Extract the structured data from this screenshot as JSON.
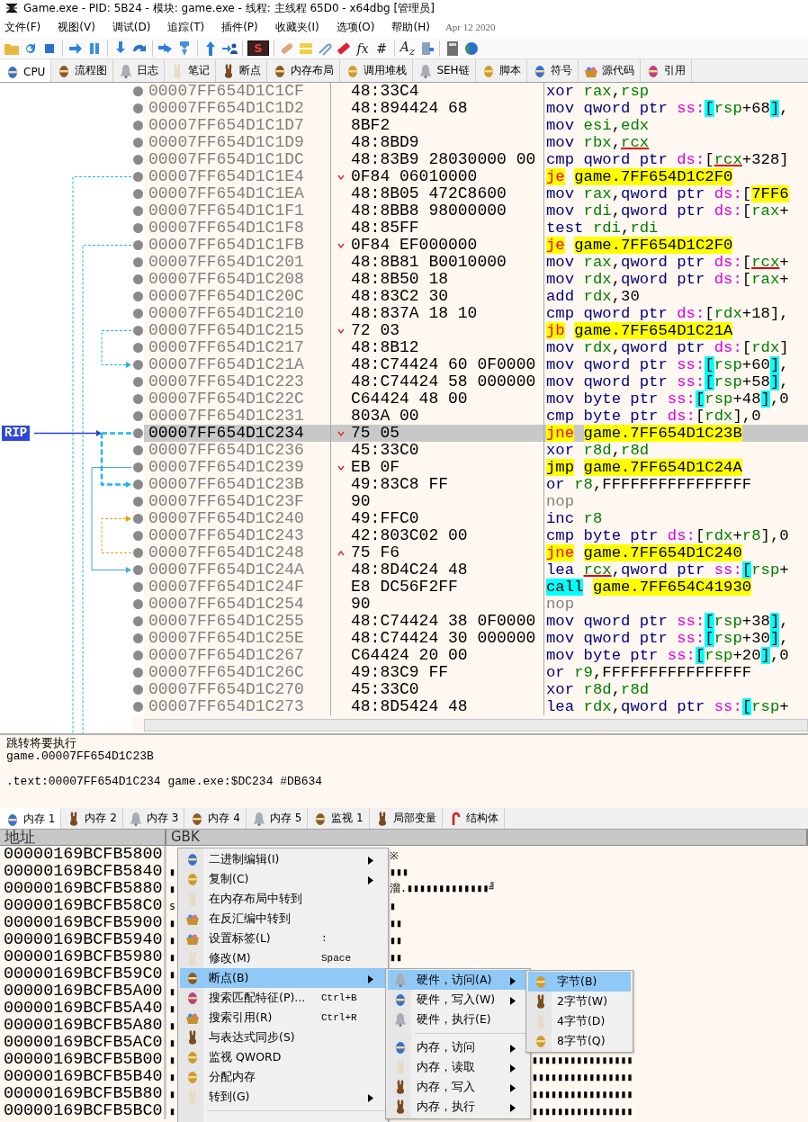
{
  "window": {
    "title": "Game.exe - PID: 5B24 - 模块: game.exe - 线程: 主线程 65D0 - x64dbg [管理员]"
  },
  "menu": [
    "文件(F)",
    "视图(V)",
    "调试(D)",
    "追踪(T)",
    "插件(P)",
    "收藏夹(I)",
    "选项(O)",
    "帮助(H)"
  ],
  "build_date": "Apr 12 2020",
  "toolbar": {
    "glyphs": [
      "S",
      "fx",
      "#",
      "A$_{z}$"
    ]
  },
  "tabs": [
    {
      "label": "CPU",
      "selected": true
    },
    {
      "label": "流程图",
      "selected": false
    },
    {
      "label": "日志",
      "selected": false
    },
    {
      "label": "笔记",
      "selected": false
    },
    {
      "label": "断点",
      "selected": false
    },
    {
      "label": "内存布局",
      "selected": false
    },
    {
      "label": "调用堆栈",
      "selected": false
    },
    {
      "label": "SEH链",
      "selected": false
    },
    {
      "label": "脚本",
      "selected": false
    },
    {
      "label": "符号",
      "selected": false
    },
    {
      "label": "源代码",
      "selected": false
    },
    {
      "label": "引用",
      "selected": false
    }
  ],
  "disassembly": {
    "rip_label": "RIP",
    "rows": [
      {
        "address": "00007FF654D1C1CF",
        "bytes": "48:33C4",
        "jump_down": false,
        "jump_up": false,
        "selected": false,
        "mnemonic": "xor",
        "kind": "op",
        "ops": [
          {
            "kind": "reg",
            "text": "rax"
          },
          {
            "kind": "punct",
            "text": ","
          },
          {
            "kind": "reg",
            "text": "rsp"
          }
        ]
      },
      {
        "address": "00007FF654D1C1D2",
        "bytes": "48:894424 68",
        "jump_down": false,
        "jump_up": false,
        "selected": false,
        "mnemonic": "mov",
        "kind": "op",
        "ops": [
          {
            "kind": "ptr",
            "text": "qword ptr "
          },
          {
            "kind": "seg",
            "text": "ss:"
          },
          {
            "kind": "sbr",
            "text": "["
          },
          {
            "kind": "reg",
            "text": "rsp"
          },
          {
            "kind": "num",
            "text": "+68"
          },
          {
            "kind": "sbr",
            "text": "]"
          },
          {
            "kind": "punct",
            "text": ","
          }
        ]
      },
      {
        "address": "00007FF654D1C1D7",
        "bytes": "8BF2",
        "jump_down": false,
        "jump_up": false,
        "selected": false,
        "mnemonic": "mov",
        "kind": "op",
        "ops": [
          {
            "kind": "reg",
            "text": "esi"
          },
          {
            "kind": "punct",
            "text": ","
          },
          {
            "kind": "reg",
            "text": "edx"
          }
        ]
      },
      {
        "address": "00007FF654D1C1D9",
        "bytes": "48:8BD9",
        "jump_down": false,
        "jump_up": false,
        "selected": false,
        "mnemonic": "mov",
        "kind": "op",
        "ops": [
          {
            "kind": "reg",
            "text": "rbx"
          },
          {
            "kind": "punct",
            "text": ","
          },
          {
            "kind": "argreg",
            "text": "rcx"
          }
        ]
      },
      {
        "address": "00007FF654D1C1DC",
        "bytes": "48:83B9 28030000 00",
        "jump_down": false,
        "jump_up": false,
        "selected": false,
        "mnemonic": "cmp",
        "kind": "op",
        "ops": [
          {
            "kind": "ptr",
            "text": "qword ptr "
          },
          {
            "kind": "seg",
            "text": "ds:"
          },
          {
            "kind": "punct",
            "text": "["
          },
          {
            "kind": "argreg",
            "text": "rcx"
          },
          {
            "kind": "num",
            "text": "+328"
          },
          {
            "kind": "punct",
            "text": "]"
          }
        ]
      },
      {
        "address": "00007FF654D1C1E4",
        "bytes": "0F84 06010000",
        "jump_down": true,
        "jump_up": false,
        "selected": false,
        "mnemonic": "je",
        "kind": "jcc",
        "ops": [
          {
            "kind": "target",
            "text": "game.7FF654D1C2F0"
          }
        ]
      },
      {
        "address": "00007FF654D1C1EA",
        "bytes": "48:8B05 472C8600",
        "jump_down": false,
        "jump_up": false,
        "selected": false,
        "mnemonic": "mov",
        "kind": "op",
        "ops": [
          {
            "kind": "reg",
            "text": "rax"
          },
          {
            "kind": "punct",
            "text": ","
          },
          {
            "kind": "ptr",
            "text": "qword ptr "
          },
          {
            "kind": "seg",
            "text": "ds:"
          },
          {
            "kind": "punct",
            "text": "["
          },
          {
            "kind": "target",
            "text": "7FF6"
          }
        ]
      },
      {
        "address": "00007FF654D1C1F1",
        "bytes": "48:8BB8 98000000",
        "jump_down": false,
        "jump_up": false,
        "selected": false,
        "mnemonic": "mov",
        "kind": "op",
        "ops": [
          {
            "kind": "reg",
            "text": "rdi"
          },
          {
            "kind": "punct",
            "text": ","
          },
          {
            "kind": "ptr",
            "text": "qword ptr "
          },
          {
            "kind": "seg",
            "text": "ds:"
          },
          {
            "kind": "punct",
            "text": "["
          },
          {
            "kind": "reg",
            "text": "rax"
          },
          {
            "kind": "num",
            "text": "+"
          }
        ]
      },
      {
        "address": "00007FF654D1C1F8",
        "bytes": "48:85FF",
        "jump_down": false,
        "jump_up": false,
        "selected": false,
        "mnemonic": "test",
        "kind": "op",
        "ops": [
          {
            "kind": "reg",
            "text": "rdi"
          },
          {
            "kind": "punct",
            "text": ","
          },
          {
            "kind": "reg",
            "text": "rdi"
          }
        ]
      },
      {
        "address": "00007FF654D1C1FB",
        "bytes": "0F84 EF000000",
        "jump_down": true,
        "jump_up": false,
        "selected": false,
        "mnemonic": "je",
        "kind": "jcc",
        "ops": [
          {
            "kind": "target",
            "text": "game.7FF654D1C2F0"
          }
        ]
      },
      {
        "address": "00007FF654D1C201",
        "bytes": "48:8B81 B0010000",
        "jump_down": false,
        "jump_up": false,
        "selected": false,
        "mnemonic": "mov",
        "kind": "op",
        "ops": [
          {
            "kind": "reg",
            "text": "rax"
          },
          {
            "kind": "punct",
            "text": ","
          },
          {
            "kind": "ptr",
            "text": "qword ptr "
          },
          {
            "kind": "seg",
            "text": "ds:"
          },
          {
            "kind": "punct",
            "text": "["
          },
          {
            "kind": "argreg",
            "text": "rcx"
          },
          {
            "kind": "num",
            "text": "+"
          }
        ]
      },
      {
        "address": "00007FF654D1C208",
        "bytes": "48:8B50 18",
        "jump_down": false,
        "jump_up": false,
        "selected": false,
        "mnemonic": "mov",
        "kind": "op",
        "ops": [
          {
            "kind": "reg",
            "text": "rdx"
          },
          {
            "kind": "punct",
            "text": ","
          },
          {
            "kind": "ptr",
            "text": "qword ptr "
          },
          {
            "kind": "seg",
            "text": "ds:"
          },
          {
            "kind": "punct",
            "text": "["
          },
          {
            "kind": "reg",
            "text": "rax"
          },
          {
            "kind": "num",
            "text": "+"
          }
        ]
      },
      {
        "address": "00007FF654D1C20C",
        "bytes": "48:83C2 30",
        "jump_down": false,
        "jump_up": false,
        "selected": false,
        "mnemonic": "add",
        "kind": "op",
        "ops": [
          {
            "kind": "reg",
            "text": "rdx"
          },
          {
            "kind": "punct",
            "text": ","
          },
          {
            "kind": "num",
            "text": "30"
          }
        ]
      },
      {
        "address": "00007FF654D1C210",
        "bytes": "48:837A 18 10",
        "jump_down": false,
        "jump_up": false,
        "selected": false,
        "mnemonic": "cmp",
        "kind": "op",
        "ops": [
          {
            "kind": "ptr",
            "text": "qword ptr "
          },
          {
            "kind": "seg",
            "text": "ds:"
          },
          {
            "kind": "punct",
            "text": "["
          },
          {
            "kind": "reg",
            "text": "rdx"
          },
          {
            "kind": "num",
            "text": "+18"
          },
          {
            "kind": "punct",
            "text": "],"
          }
        ]
      },
      {
        "address": "00007FF654D1C215",
        "bytes": "72 03",
        "jump_down": true,
        "jump_up": false,
        "selected": false,
        "mnemonic": "jb",
        "kind": "jcc",
        "ops": [
          {
            "kind": "target",
            "text": "game.7FF654D1C21A"
          }
        ]
      },
      {
        "address": "00007FF654D1C217",
        "bytes": "48:8B12",
        "jump_down": false,
        "jump_up": false,
        "selected": false,
        "mnemonic": "mov",
        "kind": "op",
        "ops": [
          {
            "kind": "reg",
            "text": "rdx"
          },
          {
            "kind": "punct",
            "text": ","
          },
          {
            "kind": "ptr",
            "text": "qword ptr "
          },
          {
            "kind": "seg",
            "text": "ds:"
          },
          {
            "kind": "punct",
            "text": "["
          },
          {
            "kind": "reg",
            "text": "rdx"
          },
          {
            "kind": "punct",
            "text": "]"
          }
        ]
      },
      {
        "address": "00007FF654D1C21A",
        "bytes": "48:C74424 60 0F0000",
        "jump_down": false,
        "jump_up": false,
        "selected": false,
        "mnemonic": "mov",
        "kind": "op",
        "ops": [
          {
            "kind": "ptr",
            "text": "qword ptr "
          },
          {
            "kind": "seg",
            "text": "ss:"
          },
          {
            "kind": "sbr",
            "text": "["
          },
          {
            "kind": "reg",
            "text": "rsp"
          },
          {
            "kind": "num",
            "text": "+60"
          },
          {
            "kind": "sbr",
            "text": "]"
          },
          {
            "kind": "punct",
            "text": ","
          }
        ]
      },
      {
        "address": "00007FF654D1C223",
        "bytes": "48:C74424 58 000000",
        "jump_down": false,
        "jump_up": false,
        "selected": false,
        "mnemonic": "mov",
        "kind": "op",
        "ops": [
          {
            "kind": "ptr",
            "text": "qword ptr "
          },
          {
            "kind": "seg",
            "text": "ss:"
          },
          {
            "kind": "sbr",
            "text": "["
          },
          {
            "kind": "reg",
            "text": "rsp"
          },
          {
            "kind": "num",
            "text": "+58"
          },
          {
            "kind": "sbr",
            "text": "]"
          },
          {
            "kind": "punct",
            "text": ","
          }
        ]
      },
      {
        "address": "00007FF654D1C22C",
        "bytes": "C64424 48 00",
        "jump_down": false,
        "jump_up": false,
        "selected": false,
        "mnemonic": "mov",
        "kind": "op",
        "ops": [
          {
            "kind": "ptr",
            "text": "byte ptr "
          },
          {
            "kind": "seg",
            "text": "ss:"
          },
          {
            "kind": "sbr",
            "text": "["
          },
          {
            "kind": "reg",
            "text": "rsp"
          },
          {
            "kind": "num",
            "text": "+48"
          },
          {
            "kind": "sbr",
            "text": "]"
          },
          {
            "kind": "punct",
            "text": ","
          },
          {
            "kind": "num",
            "text": "0"
          }
        ]
      },
      {
        "address": "00007FF654D1C231",
        "bytes": "803A 00",
        "jump_down": false,
        "jump_up": false,
        "selected": false,
        "mnemonic": "cmp",
        "kind": "op",
        "ops": [
          {
            "kind": "ptr",
            "text": "byte ptr "
          },
          {
            "kind": "seg",
            "text": "ds:"
          },
          {
            "kind": "punct",
            "text": "["
          },
          {
            "kind": "reg",
            "text": "rdx"
          },
          {
            "kind": "punct",
            "text": "],"
          },
          {
            "kind": "num",
            "text": "0"
          }
        ]
      },
      {
        "address": "00007FF654D1C234",
        "bytes": "75 05",
        "jump_down": true,
        "jump_up": false,
        "selected": true,
        "mnemonic": "jne",
        "kind": "jcc",
        "ops": [
          {
            "kind": "target",
            "text": "game.7FF654D1C23B"
          }
        ]
      },
      {
        "address": "00007FF654D1C236",
        "bytes": "45:33C0",
        "jump_down": false,
        "jump_up": false,
        "selected": false,
        "mnemonic": "xor",
        "kind": "op",
        "ops": [
          {
            "kind": "reg",
            "text": "r8d"
          },
          {
            "kind": "punct",
            "text": ","
          },
          {
            "kind": "reg",
            "text": "r8d"
          }
        ]
      },
      {
        "address": "00007FF654D1C239",
        "bytes": "EB 0F",
        "jump_down": true,
        "jump_up": false,
        "selected": false,
        "mnemonic": "jmp",
        "kind": "jmp",
        "ops": [
          {
            "kind": "target",
            "text": "game.7FF654D1C24A"
          }
        ]
      },
      {
        "address": "00007FF654D1C23B",
        "bytes": "49:83C8 FF",
        "jump_down": false,
        "jump_up": false,
        "selected": false,
        "mnemonic": "or",
        "kind": "op",
        "ops": [
          {
            "kind": "reg",
            "text": "r8"
          },
          {
            "kind": "punct",
            "text": ","
          },
          {
            "kind": "num",
            "text": "FFFFFFFFFFFFFFFF"
          }
        ]
      },
      {
        "address": "00007FF654D1C23F",
        "bytes": "90",
        "jump_down": false,
        "jump_up": false,
        "selected": false,
        "mnemonic": "nop",
        "kind": "nop",
        "ops": []
      },
      {
        "address": "00007FF654D1C240",
        "bytes": "49:FFC0",
        "jump_down": false,
        "jump_up": false,
        "selected": false,
        "mnemonic": "inc",
        "kind": "op",
        "ops": [
          {
            "kind": "reg",
            "text": "r8"
          }
        ]
      },
      {
        "address": "00007FF654D1C243",
        "bytes": "42:803C02 00",
        "jump_down": false,
        "jump_up": false,
        "selected": false,
        "mnemonic": "cmp",
        "kind": "op",
        "ops": [
          {
            "kind": "ptr",
            "text": "byte ptr "
          },
          {
            "kind": "seg",
            "text": "ds:"
          },
          {
            "kind": "punct",
            "text": "["
          },
          {
            "kind": "reg",
            "text": "rdx"
          },
          {
            "kind": "punct",
            "text": "+"
          },
          {
            "kind": "reg",
            "text": "r8"
          },
          {
            "kind": "punct",
            "text": "],"
          },
          {
            "kind": "num",
            "text": "0"
          }
        ]
      },
      {
        "address": "00007FF654D1C248",
        "bytes": "75 F6",
        "jump_down": false,
        "jump_up": true,
        "selected": false,
        "mnemonic": "jne",
        "kind": "jcc",
        "ops": [
          {
            "kind": "target",
            "text": "game.7FF654D1C240"
          }
        ]
      },
      {
        "address": "00007FF654D1C24A",
        "bytes": "48:8D4C24 48",
        "jump_down": false,
        "jump_up": false,
        "selected": false,
        "mnemonic": "lea",
        "kind": "op",
        "ops": [
          {
            "kind": "argreg",
            "text": "rcx"
          },
          {
            "kind": "punct",
            "text": ","
          },
          {
            "kind": "ptr",
            "text": "qword ptr "
          },
          {
            "kind": "seg",
            "text": "ss:"
          },
          {
            "kind": "sbr",
            "text": "["
          },
          {
            "kind": "reg",
            "text": "rsp"
          },
          {
            "kind": "num",
            "text": "+"
          }
        ]
      },
      {
        "address": "00007FF654D1C24F",
        "bytes": "E8 DC56F2FF",
        "jump_down": false,
        "jump_up": false,
        "selected": false,
        "mnemonic": "call",
        "kind": "call",
        "ops": [
          {
            "kind": "target",
            "text": "game.7FF654C41930"
          }
        ]
      },
      {
        "address": "00007FF654D1C254",
        "bytes": "90",
        "jump_down": false,
        "jump_up": false,
        "selected": false,
        "mnemonic": "nop",
        "kind": "nop",
        "ops": []
      },
      {
        "address": "00007FF654D1C255",
        "bytes": "48:C74424 38 0F0000",
        "jump_down": false,
        "jump_up": false,
        "selected": false,
        "mnemonic": "mov",
        "kind": "op",
        "ops": [
          {
            "kind": "ptr",
            "text": "qword ptr "
          },
          {
            "kind": "seg",
            "text": "ss:"
          },
          {
            "kind": "sbr",
            "text": "["
          },
          {
            "kind": "reg",
            "text": "rsp"
          },
          {
            "kind": "num",
            "text": "+38"
          },
          {
            "kind": "sbr",
            "text": "]"
          },
          {
            "kind": "punct",
            "text": ","
          }
        ]
      },
      {
        "address": "00007FF654D1C25E",
        "bytes": "48:C74424 30 000000",
        "jump_down": false,
        "jump_up": false,
        "selected": false,
        "mnemonic": "mov",
        "kind": "op",
        "ops": [
          {
            "kind": "ptr",
            "text": "qword ptr "
          },
          {
            "kind": "seg",
            "text": "ss:"
          },
          {
            "kind": "sbr",
            "text": "["
          },
          {
            "kind": "reg",
            "text": "rsp"
          },
          {
            "kind": "num",
            "text": "+30"
          },
          {
            "kind": "sbr",
            "text": "]"
          },
          {
            "kind": "punct",
            "text": ","
          }
        ]
      },
      {
        "address": "00007FF654D1C267",
        "bytes": "C64424 20 00",
        "jump_down": false,
        "jump_up": false,
        "selected": false,
        "mnemonic": "mov",
        "kind": "op",
        "ops": [
          {
            "kind": "ptr",
            "text": "byte ptr "
          },
          {
            "kind": "seg",
            "text": "ss:"
          },
          {
            "kind": "sbr",
            "text": "["
          },
          {
            "kind": "reg",
            "text": "rsp"
          },
          {
            "kind": "num",
            "text": "+20"
          },
          {
            "kind": "sbr",
            "text": "]"
          },
          {
            "kind": "punct",
            "text": ","
          },
          {
            "kind": "num",
            "text": "0"
          }
        ]
      },
      {
        "address": "00007FF654D1C26C",
        "bytes": "49:83C9 FF",
        "jump_down": false,
        "jump_up": false,
        "selected": false,
        "mnemonic": "or",
        "kind": "op",
        "ops": [
          {
            "kind": "reg",
            "text": "r9"
          },
          {
            "kind": "punct",
            "text": ","
          },
          {
            "kind": "num",
            "text": "FFFFFFFFFFFFFFFF"
          }
        ]
      },
      {
        "address": "00007FF654D1C270",
        "bytes": "45:33C0",
        "jump_down": false,
        "jump_up": false,
        "selected": false,
        "mnemonic": "xor",
        "kind": "op",
        "ops": [
          {
            "kind": "reg",
            "text": "r8d"
          },
          {
            "kind": "punct",
            "text": ","
          },
          {
            "kind": "reg",
            "text": "r8d"
          }
        ]
      },
      {
        "address": "00007FF654D1C273",
        "bytes": "48:8D5424 48",
        "jump_down": false,
        "jump_up": false,
        "selected": false,
        "mnemonic": "lea",
        "kind": "op",
        "ops": [
          {
            "kind": "reg",
            "text": "rdx"
          },
          {
            "kind": "punct",
            "text": ","
          },
          {
            "kind": "ptr",
            "text": "qword ptr "
          },
          {
            "kind": "seg",
            "text": "ss:"
          },
          {
            "kind": "sbr",
            "text": "["
          },
          {
            "kind": "reg",
            "text": "rsp"
          },
          {
            "kind": "num",
            "text": "+"
          }
        ]
      }
    ]
  },
  "info": {
    "jump": [
      "跳转将要执行",
      "game.00007FF654D1C23B"
    ],
    "location": ".text:00007FF654D1C234 game.exe:$DC234 #DB634"
  },
  "memory_tabs": [
    {
      "label": "内存 1",
      "selected": true
    },
    {
      "label": "内存 2",
      "selected": false
    },
    {
      "label": "内存 3",
      "selected": false
    },
    {
      "label": "内存 4",
      "selected": false
    },
    {
      "label": "内存 5",
      "selected": false
    },
    {
      "label": "监视 1",
      "selected": false
    },
    {
      "label": "局部变量",
      "selected": false
    },
    {
      "label": "结构体",
      "selected": false
    }
  ],
  "dump": {
    "columns": [
      "地址",
      "GBK"
    ],
    "rows": [
      {
        "address": "00000169BCFB5800",
        "gbk_right": "※",
        "kind": "menu"
      },
      {
        "address": "00000169BCFB5840",
        "gbk_left": "▮",
        "gbk_right": "▮▮▮",
        "kind": "menu"
      },
      {
        "address": "00000169BCFB5880",
        "gbk_left": "▮",
        "gbk_right": "溜.▮▮▮▮▮▮▮▮▮▮▮▮▮╝",
        "kind": "menu"
      },
      {
        "address": "00000169BCFB58C0",
        "gbk_left": "s",
        "gbk_right": "▮",
        "kind": "menu"
      },
      {
        "address": "00000169BCFB5900",
        "gbk_left": "▮",
        "gbk_right": "▮▮",
        "kind": "menu"
      },
      {
        "address": "00000169BCFB5940",
        "gbk_left": "▮",
        "gbk_right": "▮▮",
        "kind": "menu"
      },
      {
        "address": "00000169BCFB5980",
        "gbk_left": "▮",
        "gbk_right": "▮▮",
        "kind": "menu"
      },
      {
        "address": "00000169BCFB59C0",
        "gbk_left": "▮"
      },
      {
        "address": "00000169BCFB5A00",
        "gbk_left": "▮"
      },
      {
        "address": "00000169BCFB5A40",
        "gbk_left": "▮"
      },
      {
        "address": "00000169BCFB5A80",
        "gbk_left": "▮"
      },
      {
        "address": "00000169BCFB5AC0",
        "gbk_left": "▮"
      },
      {
        "address": "00000169BCFB5B00",
        "gbk_left": "▮",
        "gbk_right": "▮▮▮▮▮▮▮▮▮▮▮▮▮▮▮▮",
        "kind": "submenu"
      },
      {
        "address": "00000169BCFB5B40",
        "gbk_left": "▮",
        "gbk_right": "▮▮▮▮▮▮▮▮▮▮▮▮▮▮▮▮",
        "kind": "submenu"
      },
      {
        "address": "00000169BCFB5B80",
        "gbk_left": "▮",
        "gbk_right": "▮▮▮▮▮▮▮▮▮▮▮▮▮▮▮▮",
        "kind": "submenu"
      },
      {
        "address": "00000169BCFB5BC0",
        "gbk_left": "▮",
        "gbk_right": "▮▮▮▮▮▮▮▮▮▮▮▮▮▮▮▮",
        "kind": "submenu"
      }
    ]
  },
  "context_menu": {
    "items": [
      {
        "kind": "item",
        "label": "二进制编辑(I)",
        "has_submenu": true,
        "selected": false
      },
      {
        "kind": "item",
        "label": "复制(C)",
        "has_submenu": true,
        "selected": false
      },
      {
        "kind": "item",
        "label": "在内存布局中转到",
        "has_submenu": false,
        "selected": false
      },
      {
        "kind": "item",
        "label": "在反汇编中转到",
        "has_submenu": false,
        "selected": false
      },
      {
        "kind": "item",
        "label": "设置标签(L)",
        "shortcut": ":",
        "has_submenu": false,
        "selected": false
      },
      {
        "kind": "item",
        "label": "修改(M)",
        "shortcut": "Space",
        "has_submenu": false,
        "selected": false
      },
      {
        "kind": "item",
        "label": "断点(B)",
        "has_submenu": true,
        "selected": true
      },
      {
        "kind": "item",
        "label": "搜索匹配特征(P)...",
        "shortcut": "Ctrl+B",
        "has_submenu": false,
        "selected": false
      },
      {
        "kind": "item",
        "label": "搜索引用(R)",
        "shortcut": "Ctrl+R",
        "has_submenu": false,
        "selected": false
      },
      {
        "kind": "item",
        "label": "与表达式同步(S)",
        "has_submenu": false,
        "selected": false
      },
      {
        "kind": "item",
        "label": "监视 QWORD",
        "has_submenu": false,
        "selected": false
      },
      {
        "kind": "item",
        "label": "分配内存",
        "has_submenu": false,
        "selected": false
      },
      {
        "kind": "item",
        "label": "转到(G)",
        "has_submenu": true,
        "selected": false
      },
      {
        "kind": "separator"
      }
    ]
  },
  "breakpoint_menu": {
    "items": [
      {
        "kind": "item",
        "label": "硬件，访问(A)",
        "has_submenu": true,
        "selected": true
      },
      {
        "kind": "item",
        "label": "硬件，写入(W)",
        "has_submenu": true,
        "selected": false
      },
      {
        "kind": "item",
        "label": "硬件，执行(E)",
        "has_submenu": false,
        "selected": false
      },
      {
        "kind": "separator"
      },
      {
        "kind": "item",
        "label": "内存，访问",
        "has_submenu": true,
        "selected": false
      },
      {
        "kind": "item",
        "label": "内存，读取",
        "has_submenu": true,
        "selected": false
      },
      {
        "kind": "item",
        "label": "内存，写入",
        "has_submenu": true,
        "selected": false
      },
      {
        "kind": "item",
        "label": "内存，执行",
        "has_submenu": true,
        "selected": false
      }
    ]
  },
  "size_menu": {
    "items": [
      {
        "kind": "item",
        "label": "字节(B)",
        "has_submenu": false,
        "selected": true
      },
      {
        "kind": "item",
        "label": "2字节(W)",
        "has_submenu": false,
        "selected": false
      },
      {
        "kind": "item",
        "label": "4字节(D)",
        "has_submenu": false,
        "selected": false
      },
      {
        "kind": "item",
        "label": "8字节(Q)",
        "has_submenu": false,
        "selected": false
      }
    ]
  }
}
